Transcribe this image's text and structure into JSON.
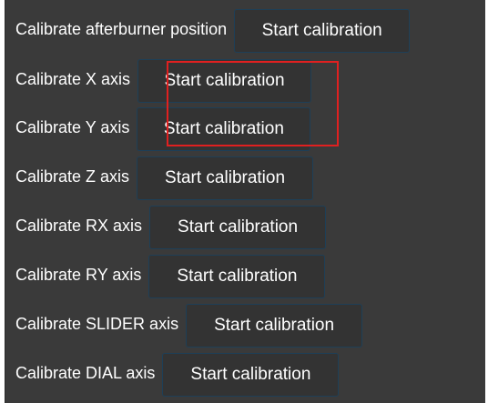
{
  "calibration": {
    "rows": [
      {
        "label": "Calibrate afterburner position",
        "button": "Start calibration"
      },
      {
        "label": "Calibrate X axis",
        "button": "Start calibration"
      },
      {
        "label": "Calibrate Y axis",
        "button": "Start calibration"
      },
      {
        "label": "Calibrate Z axis",
        "button": "Start calibration"
      },
      {
        "label": "Calibrate RX axis",
        "button": "Start calibration"
      },
      {
        "label": "Calibrate RY axis",
        "button": "Start calibration"
      },
      {
        "label": "Calibrate SLIDER axis",
        "button": "Start calibration"
      },
      {
        "label": "Calibrate DIAL axis",
        "button": "Start calibration"
      }
    ]
  },
  "colors": {
    "panel_background": "#3a3a3a",
    "button_background": "#333333",
    "button_border": "#1e3f57",
    "text": "#ffffff",
    "highlight": "#e02020"
  }
}
